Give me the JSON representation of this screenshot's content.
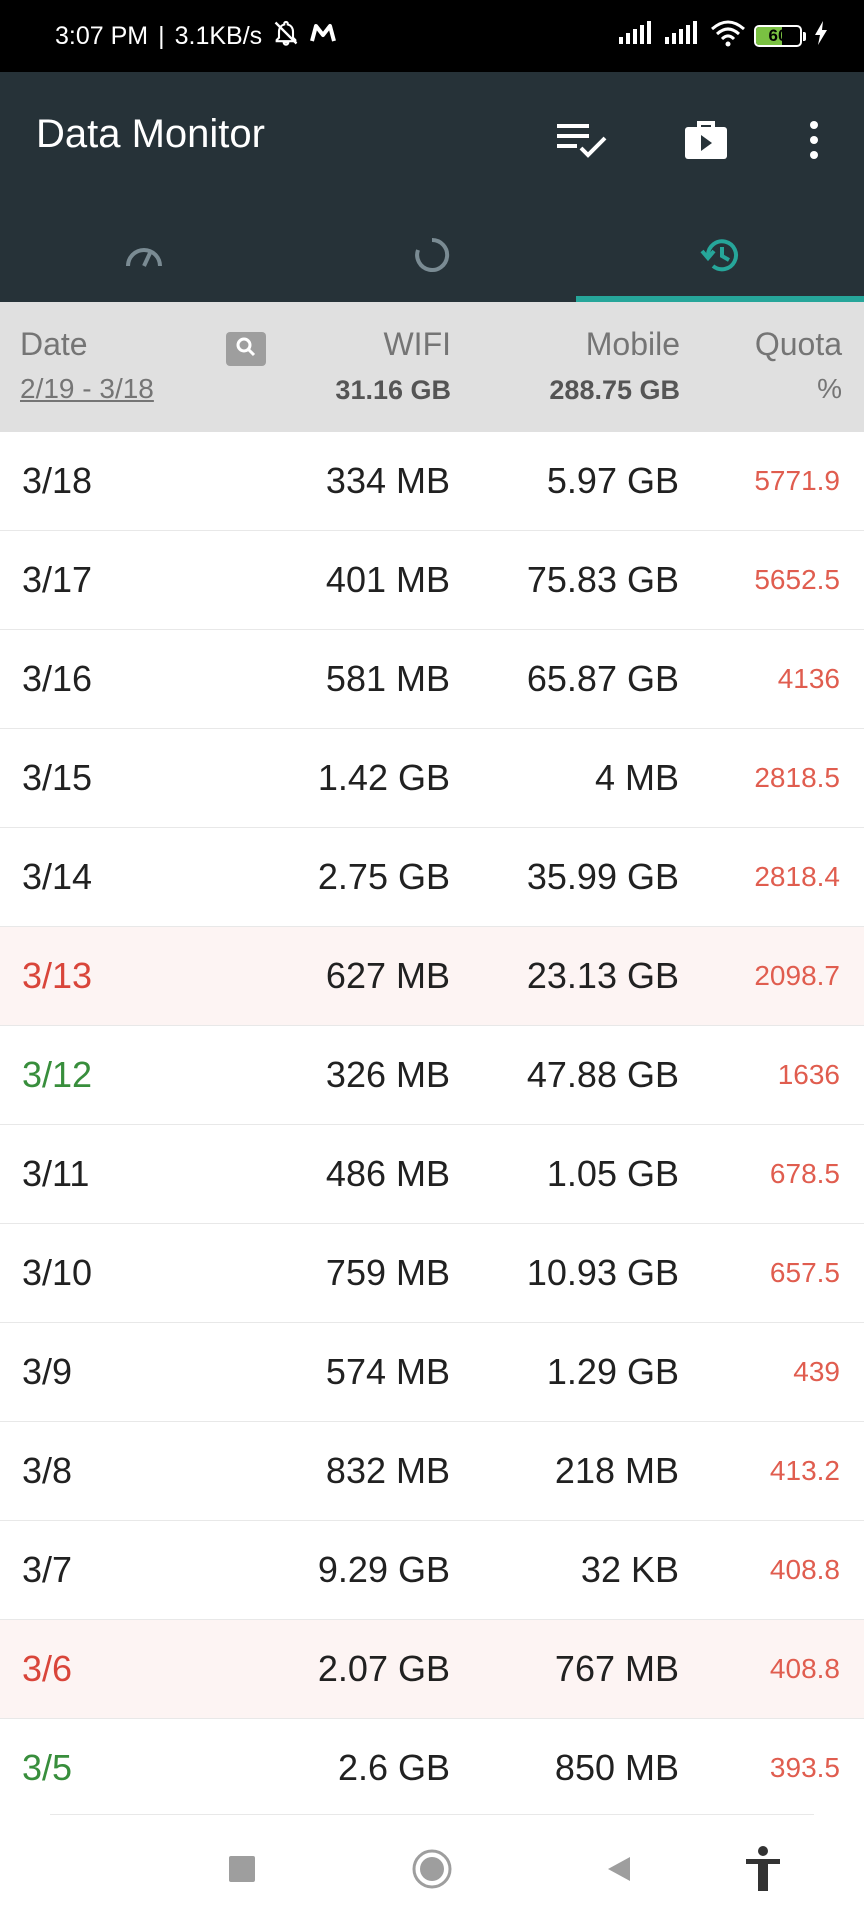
{
  "status_bar": {
    "time": "3:07 PM",
    "speed": "3.1KB/s",
    "battery": "60",
    "battery_level": 0.6,
    "icons": [
      "bell-off-icon",
      "app-m-icon",
      "signal-icon",
      "signal-icon",
      "wifi-icon",
      "battery-icon",
      "charging-icon"
    ]
  },
  "app_bar": {
    "title": "Data Monitor",
    "actions": [
      "checklist-icon",
      "briefcase-icon",
      "more-vert-icon"
    ]
  },
  "tabs": [
    {
      "icon": "speedometer-icon",
      "active": false
    },
    {
      "icon": "circle-progress-icon",
      "active": false
    },
    {
      "icon": "history-icon",
      "active": true
    }
  ],
  "colors": {
    "appbar_bg": "#263238",
    "accent": "#26a69a",
    "quota_red": "#e05d4f",
    "date_red": "#d9453a",
    "date_green": "#388e3c"
  },
  "header": {
    "date_label": "Date",
    "date_range": "2/19 - 3/18",
    "wifi_label": "WIFI",
    "wifi_total": "31.16 GB",
    "mobile_label": "Mobile",
    "mobile_total": "288.75 GB",
    "quota_label": "Quota",
    "quota_unit": "%"
  },
  "rows": [
    {
      "date": "3/18",
      "wifi": "334 MB",
      "mobile": "5.97 GB",
      "quota": "5771.9",
      "style": "normal"
    },
    {
      "date": "3/17",
      "wifi": "401 MB",
      "mobile": "75.83 GB",
      "quota": "5652.5",
      "style": "normal"
    },
    {
      "date": "3/16",
      "wifi": "581 MB",
      "mobile": "65.87 GB",
      "quota": "4136",
      "style": "normal"
    },
    {
      "date": "3/15",
      "wifi": "1.42 GB",
      "mobile": "4 MB",
      "quota": "2818.5",
      "style": "normal"
    },
    {
      "date": "3/14",
      "wifi": "2.75 GB",
      "mobile": "35.99 GB",
      "quota": "2818.4",
      "style": "normal"
    },
    {
      "date": "3/13",
      "wifi": "627 MB",
      "mobile": "23.13 GB",
      "quota": "2098.7",
      "style": "red"
    },
    {
      "date": "3/12",
      "wifi": "326 MB",
      "mobile": "47.88 GB",
      "quota": "1636",
      "style": "green"
    },
    {
      "date": "3/11",
      "wifi": "486 MB",
      "mobile": "1.05 GB",
      "quota": "678.5",
      "style": "normal"
    },
    {
      "date": "3/10",
      "wifi": "759 MB",
      "mobile": "10.93 GB",
      "quota": "657.5",
      "style": "normal"
    },
    {
      "date": "3/9",
      "wifi": "574 MB",
      "mobile": "1.29 GB",
      "quota": "439",
      "style": "normal"
    },
    {
      "date": "3/8",
      "wifi": "832 MB",
      "mobile": "218 MB",
      "quota": "413.2",
      "style": "normal"
    },
    {
      "date": "3/7",
      "wifi": "9.29 GB",
      "mobile": "32 KB",
      "quota": "408.8",
      "style": "normal"
    },
    {
      "date": "3/6",
      "wifi": "2.07 GB",
      "mobile": "767 MB",
      "quota": "408.8",
      "style": "red"
    },
    {
      "date": "3/5",
      "wifi": "2.6 GB",
      "mobile": "850 MB",
      "quota": "393.5",
      "style": "green"
    }
  ],
  "nav_bar": {
    "buttons": [
      "recents-square-icon",
      "home-circle-icon",
      "back-triangle-icon",
      "accessibility-icon"
    ]
  }
}
